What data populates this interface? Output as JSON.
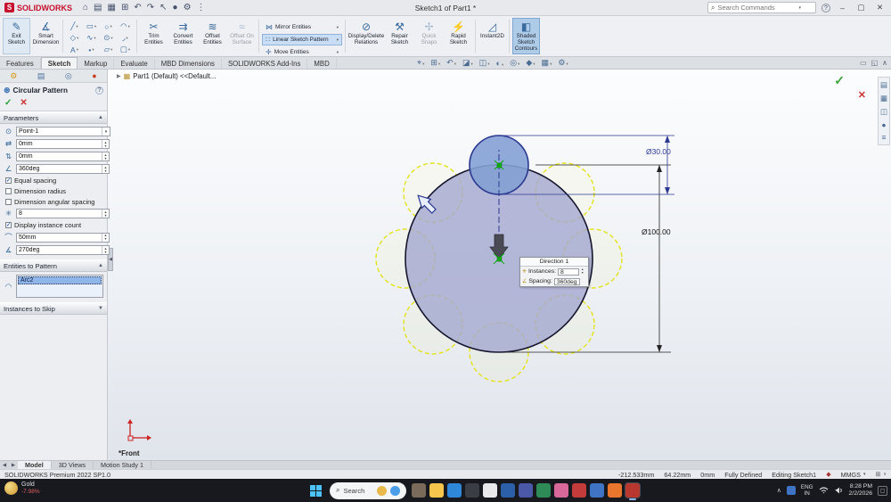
{
  "titlebar": {
    "logo_text": "SOLIDWORKS",
    "logo_mark": "S",
    "doc_title": "Sketch1 of Part1 *",
    "search_placeholder": "Search Commands",
    "quick_access_icons": [
      "home-icon",
      "open-icon",
      "save-icon",
      "print-icon",
      "undo-icon",
      "redo-icon",
      "select-icon",
      "sphere-icon",
      "gear-icon",
      "options-icon"
    ],
    "help": "?",
    "window_min": "–",
    "window_max": "▢",
    "window_close": "✕"
  },
  "ribbon": {
    "exit_sketch": "Exit\nSketch",
    "smart_dimension": "Smart\nDimension",
    "sketch_tool_icons": [
      "line-icon",
      "rectangle-icon",
      "circle-icon",
      "arc-icon",
      "polygon-icon",
      "spline-icon",
      "ellipse-icon",
      "fillet-icon",
      "text-icon",
      "point-icon",
      "plane-icon",
      "slot-icon"
    ],
    "trim_entities": "Trim\nEntities",
    "convert_entities": "Convert\nEntities",
    "offset_entities": "Offset\nEntities",
    "offset_on_surface": "Offset On\nSurface",
    "mirror_entities": "Mirror Entities",
    "linear_sketch_pattern": "Linear Sketch Pattern",
    "move_entities": "Move Entities",
    "display_delete_relations": "Display/Delete\nRelations",
    "repair_sketch": "Repair\nSketch",
    "quick_snaps": "Quick\nSnaps",
    "rapid_sketch": "Rapid\nSketch",
    "instant2d": "Instant2D",
    "shaded_sketch_contours": "Shaded\nSketch\nContours"
  },
  "tabs": [
    "Features",
    "Sketch",
    "Markup",
    "Evaluate",
    "MBD Dimensions",
    "SOLIDWORKS Add-Ins",
    "MBD"
  ],
  "headsup_icons": [
    "zoom-fit-icon",
    "zoom-area-icon",
    "previous-view-icon",
    "section-view-icon",
    "view-orientation-icon",
    "display-style-icon",
    "hide-show-items-icon",
    "edit-appearance-icon",
    "scene-icon",
    "view-settings-icon"
  ],
  "tabrow_right_icons": [
    "undock-panel-icon",
    "expand-panel-icon",
    "collapse-ribbon-icon"
  ],
  "property_panel": {
    "tab_icons": [
      "property-manager-tab-icon",
      "display-manager-tab-icon",
      "configuration-manager-tab-icon",
      "appearances-tab-icon"
    ],
    "title": "Circular Pattern",
    "help": "?",
    "parameters": {
      "header": "Parameters",
      "point_value": "Point-1",
      "offset_x": "0mm",
      "offset_y": "0mm",
      "angle": "360deg",
      "equal_spacing_label": "Equal spacing",
      "dimension_radius_label": "Dimension radius",
      "dimension_angular_label": "Dimension angular spacing",
      "instance_count": "8",
      "display_instance_count_label": "Display instance count",
      "radius": "50mm",
      "arc_angle": "270deg"
    },
    "entities": {
      "header": "Entities to Pattern",
      "item_0": "Arc2"
    },
    "skip": {
      "header": "Instances to Skip"
    }
  },
  "viewport": {
    "feature_tree_flyout": "Part1 (Default) <<Default...",
    "view_label": "*Front",
    "dim_outer": "Ø100.00",
    "dim_instance": "Ø30.00",
    "callout": {
      "title": "Direction 1",
      "instances_label": "Instances:",
      "instances_value": "8",
      "spacing_label": "Spacing:",
      "spacing_value": "360deg"
    },
    "task_pane_icons": [
      "design-library-icon",
      "file-explorer-pane-icon",
      "view-palette-icon",
      "appearances-pane-icon",
      "custom-properties-icon"
    ],
    "colors": {
      "shaded_region": "#a4a7cf",
      "selected_instance": "#84a0d4",
      "pattern_preview": "#e3e31c",
      "selection_blue": "#2b3990"
    }
  },
  "model_tabs": [
    "Model",
    "3D Views",
    "Motion Study 1"
  ],
  "statusbar": {
    "app_version": "SOLIDWORKS Premium 2022 SP1.0",
    "coord_x": "-212.533mm",
    "coord_y": "64.22mm",
    "coord_z": "0mm",
    "define_status": "Fully Defined",
    "mode": "Editing Sketch1",
    "units": "MMGS"
  },
  "taskbar": {
    "widget_title": "Gold",
    "widget_change": "-7.98%",
    "search_label": "Search",
    "apps": [
      {
        "name": "taskbar-app-store-icon",
        "color": "#7a6a5a"
      },
      {
        "name": "taskbar-file-explorer-icon",
        "color": "#f5c64b"
      },
      {
        "name": "taskbar-edge-icon",
        "color": "#2f87d8"
      },
      {
        "name": "taskbar-terminal-icon",
        "color": "#3a3d44"
      },
      {
        "name": "taskbar-notepad-icon",
        "color": "#e9e9ec"
      },
      {
        "name": "taskbar-word-icon",
        "color": "#2b5fa8"
      },
      {
        "name": "taskbar-teams-icon",
        "color": "#4b58a8"
      },
      {
        "name": "taskbar-excel-icon",
        "color": "#2e8b57"
      },
      {
        "name": "taskbar-photos-icon",
        "color": "#d8689a"
      },
      {
        "name": "taskbar-pdf-icon",
        "color": "#c43b3b"
      },
      {
        "name": "taskbar-app-blue-icon",
        "color": "#3f74c4"
      },
      {
        "name": "taskbar-firefox-icon",
        "color": "#e8762d"
      },
      {
        "name": "taskbar-solidworks-icon",
        "color": "#b8372e",
        "active": true
      }
    ],
    "tray_language": "ENG",
    "tray_region": "IN",
    "time": "8:28 PM",
    "date": "2/2/2026"
  }
}
